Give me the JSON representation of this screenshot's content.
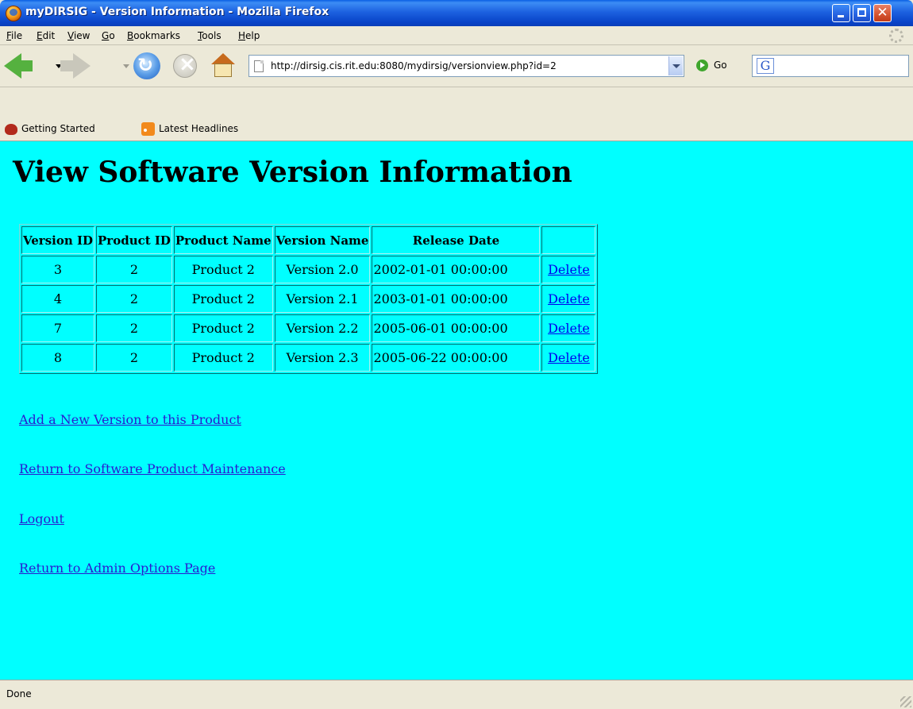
{
  "window": {
    "title": "myDIRSIG - Version Information - Mozilla Firefox"
  },
  "menu": {
    "items": [
      "File",
      "Edit",
      "View",
      "Go",
      "Bookmarks",
      "Tools",
      "Help"
    ]
  },
  "navigation": {
    "url": "http://dirsig.cis.rit.edu:8080/mydirsig/versionview.php?id=2",
    "go_label": "Go",
    "search_engine_label": "G"
  },
  "bookmarks": {
    "items": [
      "Getting Started",
      "Latest Headlines"
    ]
  },
  "page": {
    "title": "View Software Version Information",
    "table": {
      "headers": [
        "Version ID",
        "Product ID",
        "Product Name",
        "Version Name",
        "Release Date",
        ""
      ],
      "rows": [
        [
          "3",
          "2",
          "Product 2",
          "Version 2.0",
          "2002-01-01 00:00:00",
          "Delete"
        ],
        [
          "4",
          "2",
          "Product 2",
          "Version 2.1",
          "2003-01-01 00:00:00",
          "Delete"
        ],
        [
          "7",
          "2",
          "Product 2",
          "Version 2.2",
          "2005-06-01 00:00:00",
          "Delete"
        ],
        [
          "8",
          "2",
          "Product 2",
          "Version 2.3",
          "2005-06-22 00:00:00",
          "Delete"
        ]
      ]
    },
    "links": [
      "Add a New Version to this Product",
      "Return to Software Product Maintenance",
      "Logout",
      "Return to Admin Options Page"
    ]
  },
  "status": {
    "text": "Done"
  },
  "colors": {
    "page_background": "#00ffff",
    "link": "#2a1ad1",
    "titlebar": "#1d62e0",
    "chrome": "#ece9d8"
  }
}
